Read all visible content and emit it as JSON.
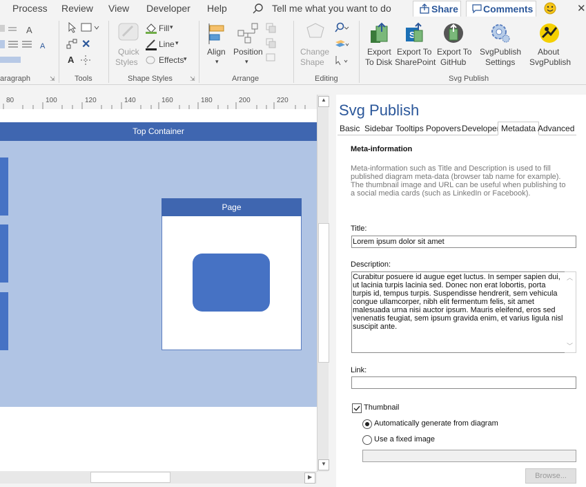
{
  "menu": {
    "items": [
      "Process",
      "Review",
      "View",
      "Developer",
      "Help"
    ],
    "tell_me": "Tell me what you want to do",
    "share": "Share",
    "comments": "Comments"
  },
  "ribbon": {
    "paragraph_label": "aragraph",
    "tools": {
      "label": "Tools"
    },
    "shape_styles": {
      "quick_styles": [
        "Quick",
        "Styles"
      ],
      "fill": "Fill",
      "line": "Line",
      "effects": "Effects",
      "label": "Shape Styles"
    },
    "arrange": {
      "align": "Align",
      "position": "Position",
      "label": "Arrange"
    },
    "editing": {
      "change_shape": [
        "Change",
        "Shape"
      ],
      "label": "Editing"
    },
    "svg_publish": {
      "label": "Svg Publish",
      "buttons": [
        {
          "l1": "Export",
          "l2": "To Disk"
        },
        {
          "l1": "Export To",
          "l2": "SharePoint"
        },
        {
          "l1": "Export To",
          "l2": "GitHub"
        },
        {
          "l1": "SvgPublish",
          "l2": "Settings"
        },
        {
          "l1": "About",
          "l2": "SvgPublish"
        }
      ]
    }
  },
  "ruler": {
    "ticks": [
      "80",
      "100",
      "120",
      "140",
      "160",
      "180",
      "200",
      "220"
    ]
  },
  "diagram": {
    "top_container": "Top Container",
    "page": "Page"
  },
  "pane": {
    "title": "Svg Publish",
    "tabs": [
      "Basic",
      "Sidebar",
      "Tooltips",
      "Popovers",
      "Developer",
      "Metadata",
      "Advanced"
    ],
    "active_tab": "Metadata",
    "section_title": "Meta-information",
    "section_desc": "Meta-information such as Title and Description is used to fill published diagram meta-data (browser tab name for example). The thumbnail image and URL can be useful when publishing to a social media cards (such as LinkedIn or Facebook).",
    "title_label": "Title:",
    "title_value": "Lorem ipsum dolor sit amet",
    "description_label": "Description:",
    "description_value": "Curabitur posuere id augue eget luctus. In semper sapien dui, ut lacinia turpis lacinia sed. Donec non erat lobortis, porta turpis id, tempus turpis. Suspendisse hendrerit, sem vehicula congue ullamcorper, nibh elit fermentum felis, sit amet malesuada urna nisi auctor ipsum. Mauris eleifend, eros sed venenatis feugiat, sem ipsum gravida enim, et varius ligula nisl suscipit ante.",
    "link_label": "Link:",
    "link_value": "",
    "thumbnail_label": "Thumbnail",
    "thumbnail_checked": true,
    "radio_auto": "Automatically generate from diagram",
    "radio_fixed": "Use a fixed image",
    "browse": "Browse..."
  },
  "colors": {
    "accent": "#2b579a",
    "container": "#b0c4e4",
    "header": "#3f66b0",
    "shape": "#4672c4"
  }
}
